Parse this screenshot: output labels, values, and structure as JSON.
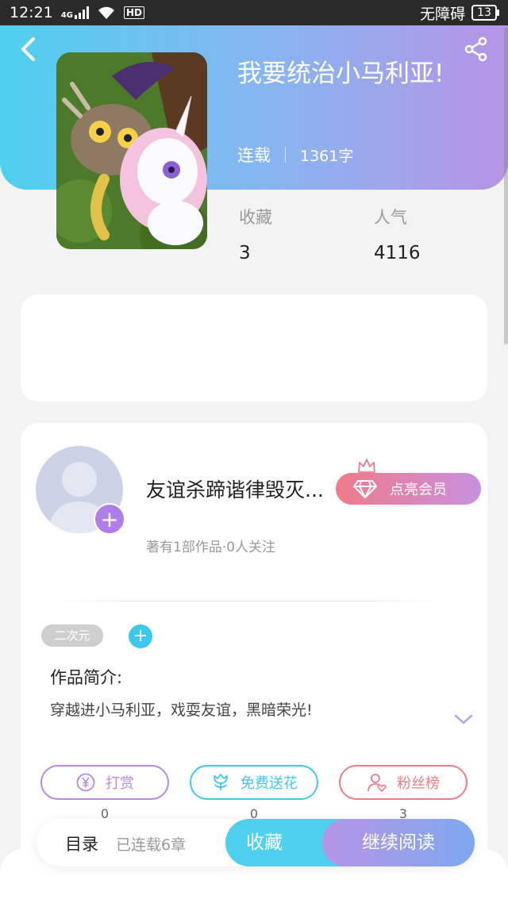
{
  "status_bar": {
    "time": "12:21",
    "network": "4G",
    "hd": "HD",
    "accessibility": "无障碍",
    "battery": "13"
  },
  "book": {
    "title": "我要统治小马利亚!",
    "status": "连载",
    "word_count": "1361字",
    "favorites_label": "收藏",
    "favorites_value": "3",
    "popularity_label": "人气",
    "popularity_value": "4116"
  },
  "author": {
    "name": "友谊杀蹄谐律毁灭...",
    "meta": "著有1部作品·0人关注",
    "vip_label": "点亮会员"
  },
  "tags": [
    "二次元"
  ],
  "intro": {
    "heading": "作品简介:",
    "text": "穿越进小马利亚，戏耍友谊，黑暗荣光!"
  },
  "actions": [
    {
      "label": "打赏",
      "count": "0",
      "color": "#b689e8"
    },
    {
      "label": "免费送花",
      "count": "0",
      "color": "#3ec8f0"
    },
    {
      "label": "粉丝榜",
      "count": "3",
      "color": "#f07a88"
    }
  ],
  "bottom_bar": {
    "toc_label": "目录",
    "toc_sub": "已连载6章",
    "favorite_button": "收藏",
    "read_button": "继续阅读"
  }
}
